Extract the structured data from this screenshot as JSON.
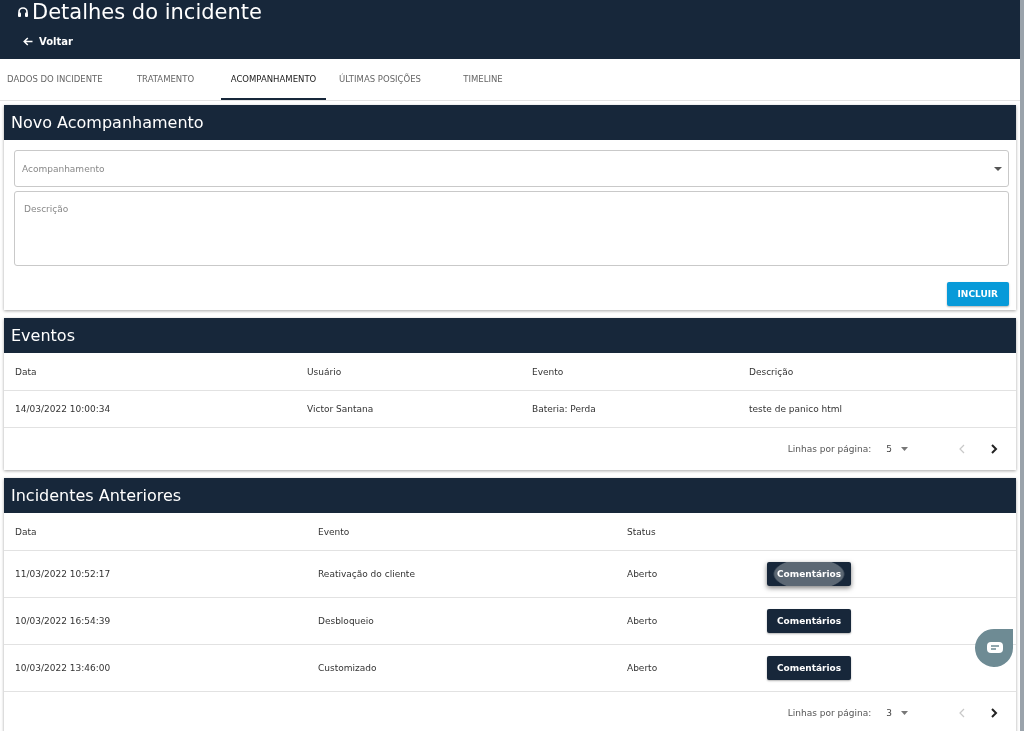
{
  "header": {
    "title": "Detalhes do incidente",
    "back_label": "Voltar"
  },
  "tabs": [
    {
      "label": "DADOS DO INCIDENTE",
      "selected": false
    },
    {
      "label": "TRATAMENTO",
      "selected": false
    },
    {
      "label": "ACOMPANHAMENTO",
      "selected": true
    },
    {
      "label": "ÚLTIMAS POSIÇÕES",
      "selected": false
    },
    {
      "label": "TIMELINE",
      "selected": false
    }
  ],
  "new_followup": {
    "title": "Novo Acompanhamento",
    "select_placeholder": "Acompanhamento",
    "description_placeholder": "Descrição",
    "submit_label": "INCLUIR"
  },
  "events": {
    "title": "Eventos",
    "columns": [
      "Data",
      "Usuário",
      "Evento",
      "Descrição"
    ],
    "rows": [
      [
        "14/03/2022 10:00:34",
        "Victor Santana",
        "Bateria: Perda",
        "teste de panico html"
      ]
    ],
    "pagination": {
      "label": "Linhas por página:",
      "rows_per_page": "5",
      "previous_disabled": true,
      "next_disabled": false
    }
  },
  "previous_incidents": {
    "title": "Incidentes Anteriores",
    "columns": [
      "Data",
      "Evento",
      "Status"
    ],
    "rows": [
      {
        "cells": [
          "11/03/2022 10:52:17",
          "Reativação do cliente",
          "Aberto"
        ],
        "button": "Comentários",
        "focused": true
      },
      {
        "cells": [
          "10/03/2022 16:54:39",
          "Desbloqueio",
          "Aberto"
        ],
        "button": "Comentários",
        "focused": false
      },
      {
        "cells": [
          "10/03/2022 13:46:00",
          "Customizado",
          "Aberto"
        ],
        "button": "Comentários",
        "focused": false
      }
    ],
    "pagination": {
      "label": "Linhas por página:",
      "rows_per_page": "3",
      "previous_disabled": true,
      "next_disabled": false
    }
  }
}
